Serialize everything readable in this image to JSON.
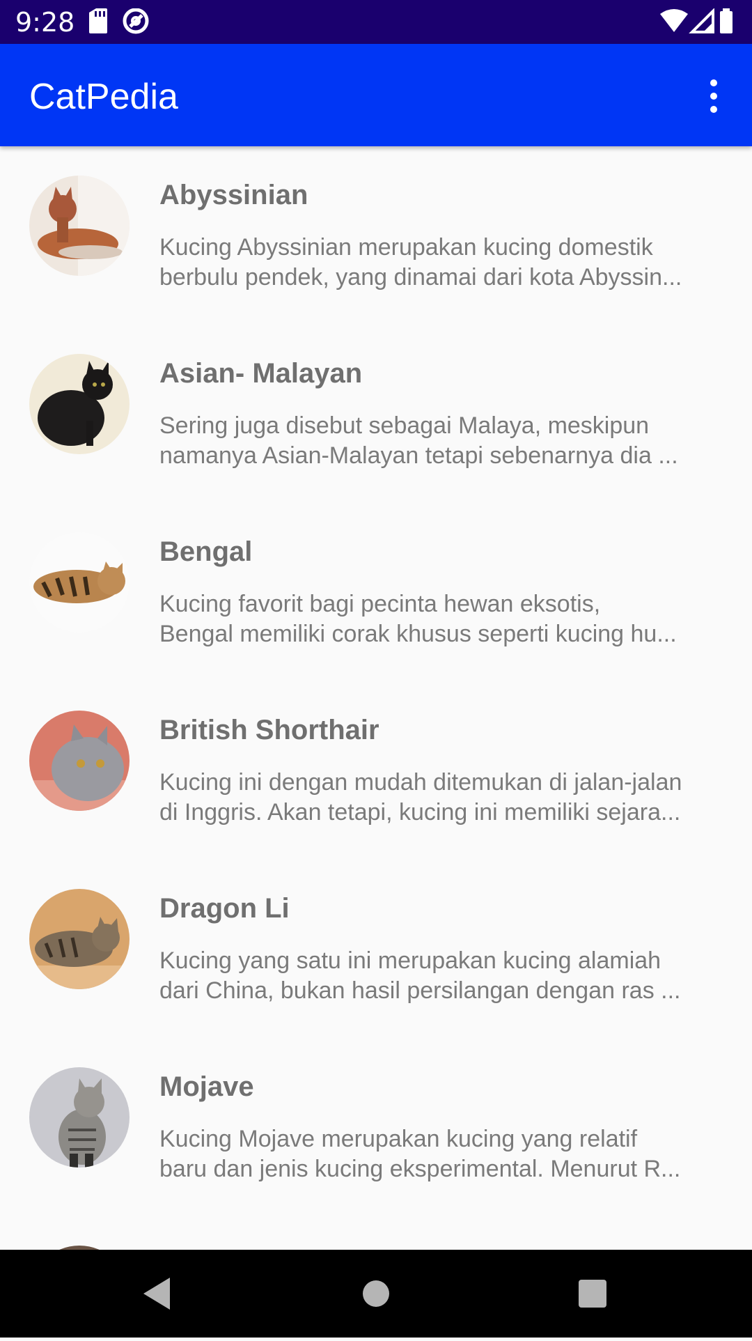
{
  "status_bar": {
    "time": "9:28",
    "icons_left": [
      "sd-card-icon",
      "at-sign-icon"
    ],
    "icons_right": [
      "wifi-icon",
      "cell-signal-icon",
      "battery-icon"
    ],
    "color": "#1a006e"
  },
  "app_bar": {
    "title": "CatPedia",
    "color": "#0036f5",
    "menu_icon": "more-vert-icon"
  },
  "cats": [
    {
      "name": "Abyssinian",
      "desc_line1": "Kucing Abyssinian merupakan kucing domestik",
      "desc_line2": "berbulu pendek, yang dinamai dari kota Abyssin..."
    },
    {
      "name": "Asian- Malayan",
      "desc_line1": "Sering juga disebut sebagai Malaya, meskipun",
      "desc_line2": "namanya Asian-Malayan tetapi sebenarnya dia ..."
    },
    {
      "name": "Bengal",
      "desc_line1": "Kucing favorit bagi pecinta hewan eksotis,",
      "desc_line2": "Bengal memiliki corak khusus seperti kucing hu..."
    },
    {
      "name": "British Shorthair",
      "desc_line1": "Kucing ini dengan mudah ditemukan di jalan-jalan",
      "desc_line2": "di Inggris. Akan tetapi, kucing ini memiliki sejara..."
    },
    {
      "name": "Dragon Li",
      "desc_line1": "Kucing yang satu ini merupakan kucing alamiah",
      "desc_line2": "dari China, bukan hasil persilangan dengan ras ..."
    },
    {
      "name": "Mojave",
      "desc_line1": "Kucing Mojave merupakan kucing yang relatif",
      "desc_line2": "baru dan jenis kucing eksperimental. Menurut R..."
    }
  ],
  "nav_bar": {
    "icons": [
      "back-icon",
      "home-icon",
      "recents-icon"
    ]
  }
}
